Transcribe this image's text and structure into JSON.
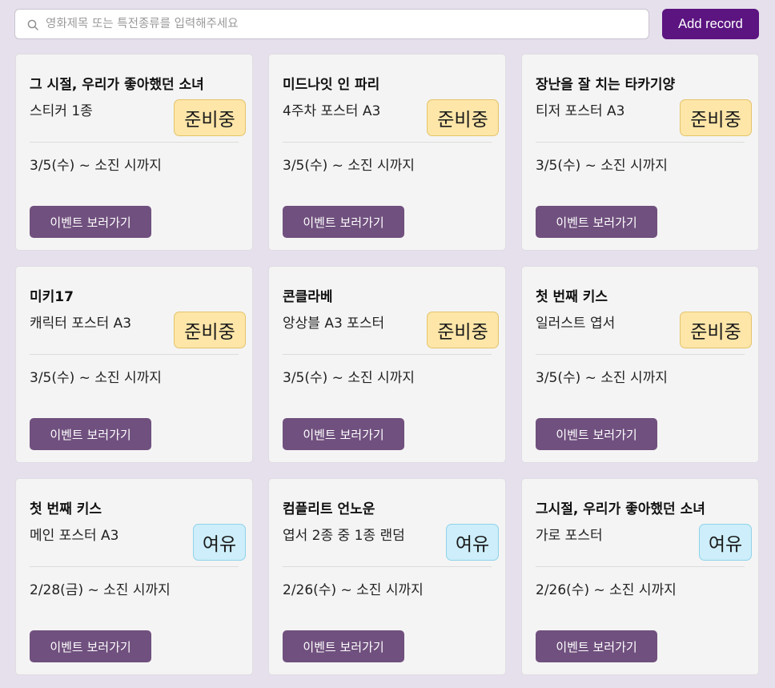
{
  "search": {
    "placeholder": "영화제목 또는 특전종류를 입력해주세요",
    "value": ""
  },
  "toolbar": {
    "add_label": "Add record"
  },
  "colors": {
    "background": "#e6dfec",
    "add_button": "#5b1480",
    "event_button": "#70507e",
    "badge_prep": "#fde6a8",
    "badge_ample": "#cdeefa"
  },
  "cards": [
    {
      "title": "그 시절, 우리가 좋아했던 소녀",
      "subtitle": "스티커 1종",
      "badge": "준비중",
      "badge_type": "prep",
      "period": "3/5(수) ~ 소진 시까지",
      "button": "이벤트 보러가기"
    },
    {
      "title": "미드나잇 인 파리",
      "subtitle": "4주차 포스터 A3",
      "badge": "준비중",
      "badge_type": "prep",
      "period": "3/5(수) ~ 소진 시까지",
      "button": "이벤트 보러가기"
    },
    {
      "title": "장난을 잘 치는 타카기양",
      "subtitle": "티저 포스터 A3",
      "badge": "준비중",
      "badge_type": "prep",
      "period": "3/5(수) ~ 소진 시까지",
      "button": "이벤트 보러가기"
    },
    {
      "title": "미키17",
      "subtitle": "캐릭터 포스터 A3",
      "badge": "준비중",
      "badge_type": "prep",
      "period": "3/5(수) ~ 소진 시까지",
      "button": "이벤트 보러가기"
    },
    {
      "title": "콘클라베",
      "subtitle": "앙상블 A3 포스터",
      "badge": "준비중",
      "badge_type": "prep",
      "period": "3/5(수) ~ 소진 시까지",
      "button": "이벤트 보러가기"
    },
    {
      "title": "첫 번째 키스",
      "subtitle": "일러스트 엽서",
      "badge": "준비중",
      "badge_type": "prep",
      "period": "3/5(수) ~ 소진 시까지",
      "button": "이벤트 보러가기"
    },
    {
      "title": "첫 번째 키스",
      "subtitle": "메인 포스터 A3",
      "badge": "여유",
      "badge_type": "ample",
      "period": "2/28(금) ~ 소진 시까지",
      "button": "이벤트 보러가기"
    },
    {
      "title": "컴플리트 언노운",
      "subtitle": "엽서 2종 중 1종 랜덤",
      "badge": "여유",
      "badge_type": "ample",
      "period": "2/26(수) ~ 소진 시까지",
      "button": "이벤트 보러가기"
    },
    {
      "title": "그시절, 우리가 좋아했던 소녀",
      "subtitle": "가로 포스터",
      "badge": "여유",
      "badge_type": "ample",
      "period": "2/26(수) ~ 소진 시까지",
      "button": "이벤트 보러가기"
    }
  ]
}
